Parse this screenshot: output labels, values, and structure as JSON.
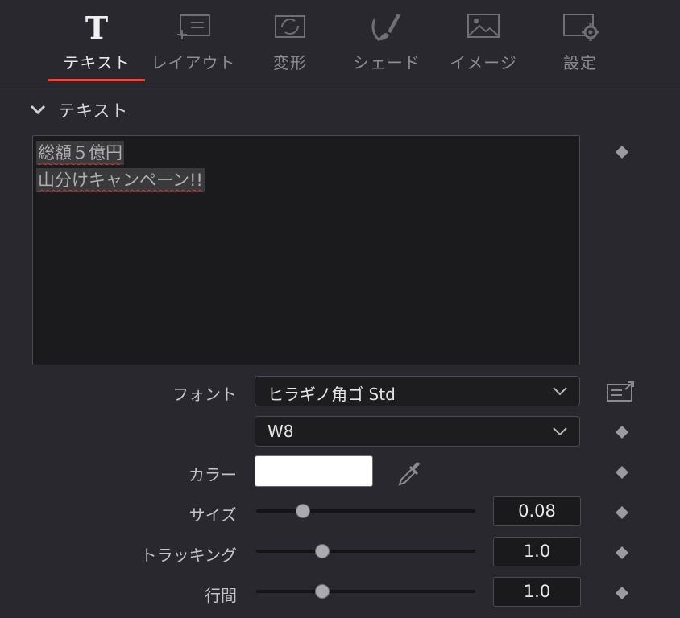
{
  "tabs": [
    {
      "label": "テキスト",
      "icon": "text-T-icon",
      "active": true
    },
    {
      "label": "レイアウト",
      "icon": "layout-icon",
      "active": false
    },
    {
      "label": "変形",
      "icon": "transform-icon",
      "active": false
    },
    {
      "label": "シェード",
      "icon": "brush-icon",
      "active": false
    },
    {
      "label": "イメージ",
      "icon": "image-icon",
      "active": false
    },
    {
      "label": "設定",
      "icon": "settings-icon",
      "active": false
    }
  ],
  "section": {
    "title": "テキスト"
  },
  "text_content": {
    "line1": "総額５億円",
    "line2": "山分けキャンペーン!!"
  },
  "font": {
    "label": "フォント",
    "family": "ヒラギノ角ゴ Std",
    "weight": "W8"
  },
  "color": {
    "label": "カラー",
    "value": "#ffffff"
  },
  "size": {
    "label": "サイズ",
    "value": "0.08",
    "slider_fraction": 0.18
  },
  "tracking": {
    "label": "トラッキング",
    "value": "1.0",
    "slider_fraction": 0.27
  },
  "line_spacing": {
    "label": "行間",
    "value": "1.0",
    "slider_fraction": 0.27
  },
  "colors": {
    "accent": "#e24b3f",
    "background": "#28282e"
  }
}
